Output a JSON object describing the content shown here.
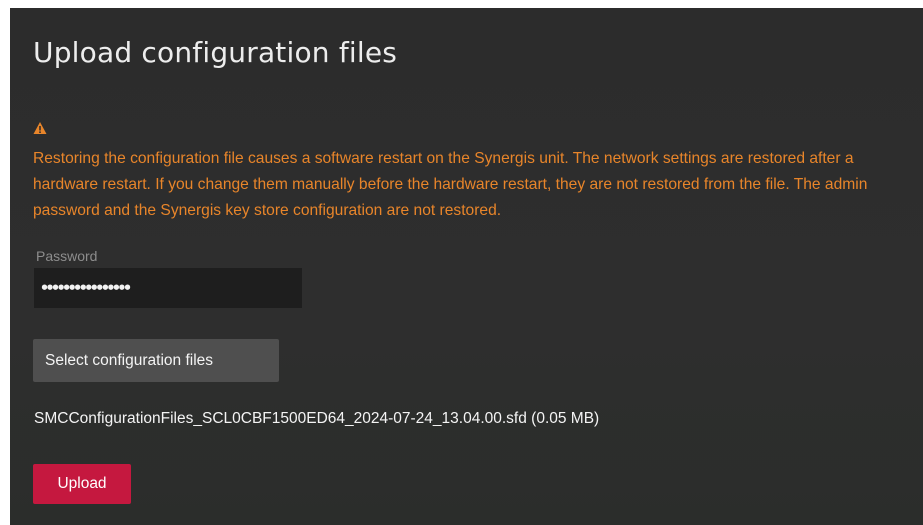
{
  "page": {
    "title": "Upload configuration files"
  },
  "warning": {
    "icon": "warning-triangle-icon",
    "color": "#e8852a",
    "text": "Restoring the configuration file causes a software restart on the Synergis unit. The network settings are restored after a hardware restart. If you change them manually before the hardware restart, they are not restored from the file. The admin password and the Synergis key store configuration are not restored."
  },
  "password": {
    "label": "Password",
    "value": "••••••••••••••••"
  },
  "select_button": {
    "label": "Select configuration files"
  },
  "selected_file": {
    "text": "SMCConfigurationFiles_SCL0CBF1500ED64_2024-07-24_13.04.00.sfd (0.05 MB)"
  },
  "upload_button": {
    "label": "Upload",
    "color": "#c5183f"
  }
}
